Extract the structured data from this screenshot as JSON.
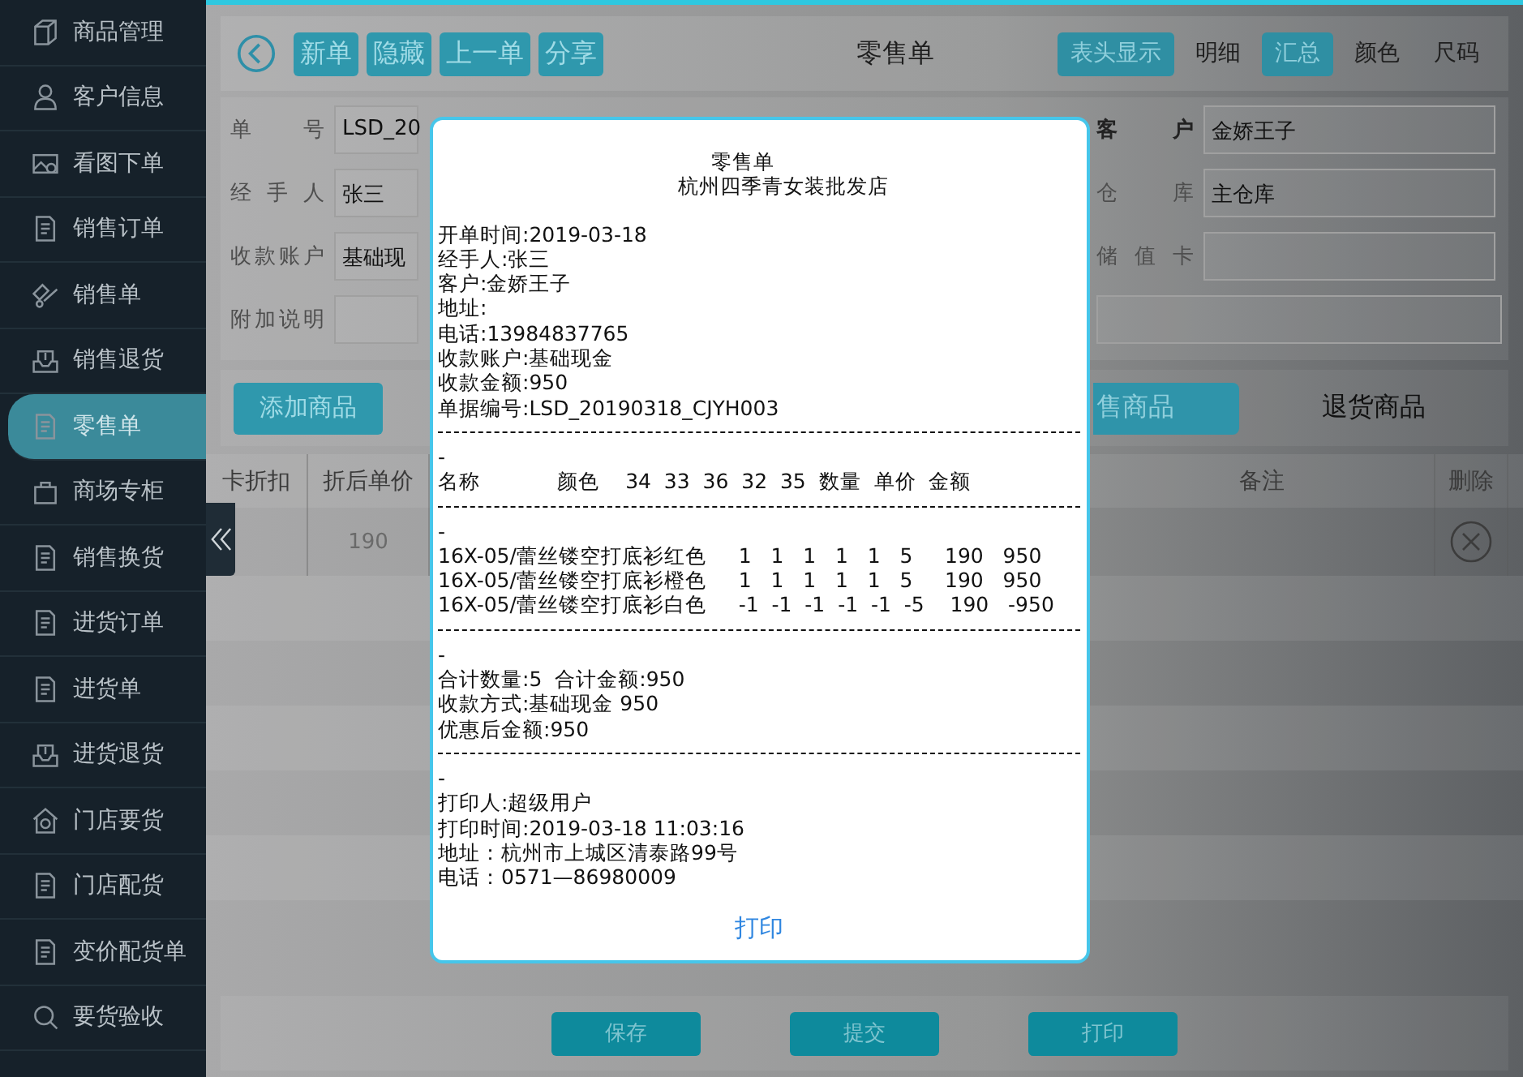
{
  "sidebar": {
    "items": [
      {
        "label": "商品管理",
        "selected": false
      },
      {
        "label": "客户信息",
        "selected": false
      },
      {
        "label": "看图下单",
        "selected": false
      },
      {
        "label": "销售订单",
        "selected": false
      },
      {
        "label": "销售单",
        "selected": false
      },
      {
        "label": "销售退货",
        "selected": false
      },
      {
        "label": "零售单",
        "selected": true
      },
      {
        "label": "商场专柜",
        "selected": false
      },
      {
        "label": "销售换货",
        "selected": false
      },
      {
        "label": "进货订单",
        "selected": false
      },
      {
        "label": "进货单",
        "selected": false
      },
      {
        "label": "进货退货",
        "selected": false
      },
      {
        "label": "门店要货",
        "selected": false
      },
      {
        "label": "门店配货",
        "selected": false
      },
      {
        "label": "变价配货单",
        "selected": false
      },
      {
        "label": "要货验收",
        "selected": false
      }
    ]
  },
  "toolbar": {
    "buttons": [
      "新单",
      "隐藏",
      "上一单",
      "分享"
    ],
    "title": "零售单",
    "tabs": [
      {
        "label": "表头显示",
        "selected": true
      },
      {
        "label": "明细",
        "selected": false
      },
      {
        "label": "汇总",
        "selected": true
      },
      {
        "label": "颜色",
        "selected": false
      },
      {
        "label": "尺码",
        "selected": false
      }
    ]
  },
  "form": {
    "left": [
      {
        "label": "单 号",
        "value": "LSD_20",
        "required": false
      },
      {
        "label": "经 手 人",
        "value": "张三",
        "required": false
      },
      {
        "label": "收款账户",
        "value": "基础现",
        "required": false
      },
      {
        "label": "附加说明",
        "required": false
      }
    ],
    "right": [
      {
        "label": "客 户",
        "value": "金娇王子",
        "required": true
      },
      {
        "label": "仓 库",
        "value": "主仓库",
        "required": false
      },
      {
        "label": "储 值 卡",
        "required": false
      }
    ]
  },
  "add_button": "添加商品",
  "goods_tabs": [
    {
      "label": "售商品",
      "selected": true
    },
    {
      "label": "退货商品",
      "selected": false
    }
  ],
  "table": {
    "columns": [
      "卡折扣",
      "折后单价",
      "备注",
      "删除"
    ],
    "rows": [
      {
        "price": "190"
      }
    ]
  },
  "footer_buttons": [
    "保存",
    "提交",
    "打印"
  ],
  "dialog": {
    "lines": [
      {
        "kind": "title",
        "text": "零售单"
      },
      {
        "kind": "title",
        "text": "杭州四季青女装批发店"
      },
      {
        "kind": "gap"
      },
      {
        "kind": "text",
        "text": "开单时间:2019-03-18"
      },
      {
        "kind": "text",
        "text": "经手人:张三"
      },
      {
        "kind": "text",
        "text": "客户:金娇王子"
      },
      {
        "kind": "text",
        "text": "地址:"
      },
      {
        "kind": "text",
        "text": "电话:13984837765"
      },
      {
        "kind": "text",
        "text": "收款账户:基础现金"
      },
      {
        "kind": "text",
        "text": "收款金额:950"
      },
      {
        "kind": "text",
        "text": "单据编号:LSD_20190318_CJYH003"
      },
      {
        "kind": "separator"
      },
      {
        "kind": "text",
        "text": "-"
      },
      {
        "kind": "text",
        "text": "名称            颜色    34  33  36  32  35  数量  单价  金额"
      },
      {
        "kind": "separator"
      },
      {
        "kind": "text",
        "text": "-"
      },
      {
        "kind": "text",
        "text": "16X-05/蕾丝镂空打底衫红色     1   1   1   1   1   5     190   950"
      },
      {
        "kind": "text",
        "text": "16X-05/蕾丝镂空打底衫橙色     1   1   1   1   1   5     190   950"
      },
      {
        "kind": "text",
        "text": "16X-05/蕾丝镂空打底衫白色     -1  -1  -1  -1  -1  -5    190   -950"
      },
      {
        "kind": "separator"
      },
      {
        "kind": "text",
        "text": "-"
      },
      {
        "kind": "text",
        "text": "合计数量:5  合计金额:950"
      },
      {
        "kind": "text",
        "text": "收款方式:基础现金 950"
      },
      {
        "kind": "text",
        "text": "优惠后金额:950"
      },
      {
        "kind": "separator"
      },
      {
        "kind": "text",
        "text": "-"
      },
      {
        "kind": "text",
        "text": "打印人:超级用户"
      },
      {
        "kind": "text",
        "text": "打印时间:2019-03-18 11:03:16"
      },
      {
        "kind": "text",
        "text": "地址：杭州市上城区清泰路99号"
      },
      {
        "kind": "text",
        "text": "电话：0571—86980009"
      }
    ],
    "button": "打印"
  }
}
